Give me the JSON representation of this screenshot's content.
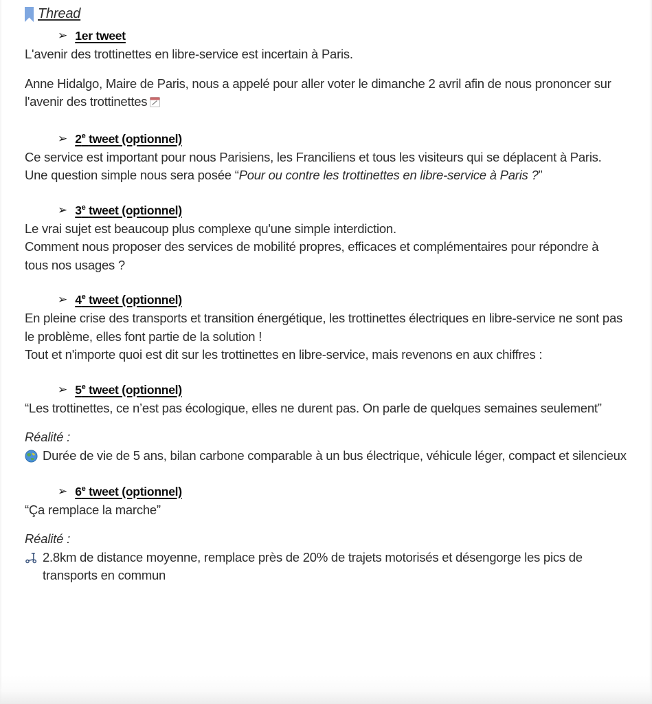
{
  "document": {
    "title": "Thread",
    "title_icon": "bookmark-icon",
    "bookmark_color": "#7fa7e0",
    "text_color": "#2d2d2d",
    "heading_color": "#0b0b0b",
    "arrow_glyph": "➢",
    "sections": [
      {
        "id": "tweet-1",
        "heading": {
          "number": "1er",
          "label": "1er tweet",
          "optional_suffix": ""
        },
        "paragraphs": [
          "L'avenir des trottinettes en libre-service est incertain à Paris.",
          "Anne Hidalgo, Maire de Paris, nous a appelé pour aller voter le dimanche 2 avril afin de nous prononcer sur l'avenir des trottinettes"
        ],
        "trailing_emoji": "calendar-emoji"
      },
      {
        "id": "tweet-2",
        "heading": {
          "number": "2",
          "ordinal_superscript": "e",
          "label": "tweet (optionnel)"
        },
        "paragraphs": [
          "Ce service est important pour nous Parisiens, les Franciliens et tous les visiteurs qui se déplacent à Paris."
        ],
        "quote_intro": "Une question simple nous sera posée “",
        "quote_italic": "Pour ou contre les trottinettes en libre-service à Paris ?",
        "quote_close": "”"
      },
      {
        "id": "tweet-3",
        "heading": {
          "number": "3",
          "ordinal_superscript": "e",
          "label": "tweet (optionnel)"
        },
        "paragraphs": [
          "Le vrai sujet est beaucoup plus complexe qu'une simple interdiction.",
          "Comment nous proposer des services de mobilité propres, efficaces et complémentaires pour répondre à tous nos usages ?"
        ]
      },
      {
        "id": "tweet-4",
        "heading": {
          "number": "4",
          "ordinal_superscript": "e",
          "label": "tweet (optionnel)"
        },
        "paragraphs": [
          "En pleine crise des transports et transition énergétique, les trottinettes électriques en libre-service ne sont pas le problème, elles font partie de la solution !",
          "Tout et n'importe quoi est dit sur les trottinettes en libre-service, mais revenons en aux chiffres :"
        ]
      },
      {
        "id": "tweet-5",
        "heading": {
          "number": "5",
          "ordinal_superscript": "e",
          "label": "tweet (optionnel)"
        },
        "quote": "“Les trottinettes, ce n’est pas écologique, elles ne durent pas. On parle de quelques semaines seulement”",
        "reality_label": "Réalité :",
        "reality_emoji": "globe-emoji",
        "reality_text": "Durée de vie de 5 ans, bilan carbone comparable à un bus électrique, véhicule léger, compact et silencieux"
      },
      {
        "id": "tweet-6",
        "heading": {
          "number": "6",
          "ordinal_superscript": "e",
          "label": "tweet (optionnel)"
        },
        "quote": "“Ça remplace la marche”",
        "reality_label": "Réalité :",
        "reality_emoji": "scooter-emoji",
        "reality_text": "2.8km de distance moyenne, remplace près de 20% de trajets motorisés et désengorge les pics de transports en commun"
      }
    ]
  }
}
